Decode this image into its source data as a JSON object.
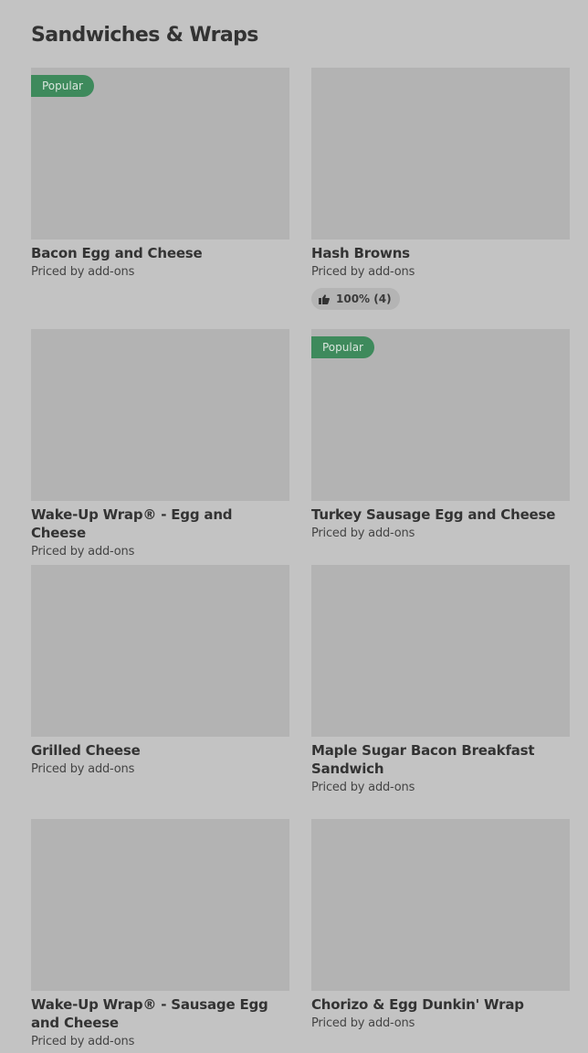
{
  "section": {
    "title": "Sandwiches & Wraps"
  },
  "items": [
    {
      "name": "Bacon Egg and Cheese",
      "price": "Priced by add-ons",
      "badge": "Popular"
    },
    {
      "name": "Hash Browns",
      "price": "Priced by add-ons",
      "rating": "100% (4)",
      "rating_icon": "thumbs-up-icon"
    },
    {
      "name": "Wake-Up Wrap® - Egg and Cheese",
      "price": "Priced by add-ons"
    },
    {
      "name": "Turkey Sausage Egg and Cheese",
      "price": "Priced by add-ons",
      "badge": "Popular"
    },
    {
      "name": "Grilled Cheese",
      "price": "Priced by add-ons"
    },
    {
      "name": "Maple Sugar Bacon Breakfast Sandwich",
      "price": "Priced by add-ons"
    },
    {
      "name": "Wake-Up Wrap® - Sausage Egg and Cheese",
      "price": "Priced by add-ons"
    },
    {
      "name": "Chorizo & Egg Dunkin' Wrap",
      "price": "Priced by add-ons"
    }
  ],
  "colors": {
    "background": "#c3c3c3",
    "thumbnail_placeholder": "#b3b3b3",
    "popular_badge": "#3e8a5c",
    "text": "#333333"
  }
}
